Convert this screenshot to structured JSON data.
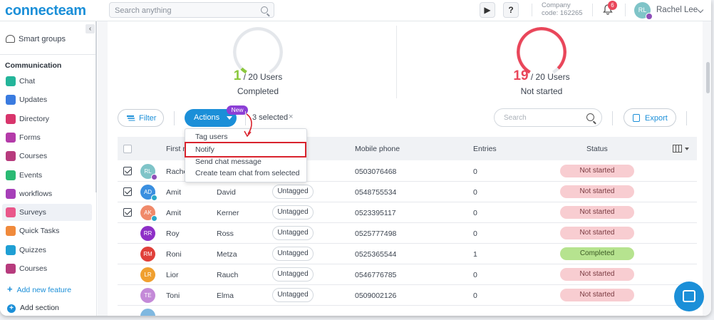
{
  "brand": {
    "logo": "connecteam",
    "accent": "#1b8fd8"
  },
  "topbar": {
    "search_placeholder": "Search anything",
    "help_label": "?",
    "company_line1": "Company",
    "company_line2": "code: 162265",
    "notifications": "6",
    "avatar_initials": "RL",
    "user_name": "Rachel Lee"
  },
  "sidebar": {
    "smart_groups": "Smart groups",
    "section": "Communication",
    "items": [
      {
        "label": "Chat",
        "color": "#24b59a"
      },
      {
        "label": "Updates",
        "color": "#3a7be0"
      },
      {
        "label": "Directory",
        "color": "#d8356c"
      },
      {
        "label": "Forms",
        "color": "#b43ba9"
      },
      {
        "label": "Courses",
        "color": "#b73b7d"
      },
      {
        "label": "Events",
        "color": "#2aba73"
      },
      {
        "label": "workflows",
        "color": "#a63fb8"
      },
      {
        "label": "Surveys",
        "color": "#e9578a"
      },
      {
        "label": "Quick Tasks",
        "color": "#f08a3c"
      },
      {
        "label": "Quizzes",
        "color": "#1f9fd4"
      },
      {
        "label": "Courses",
        "color": "#b73b7d"
      }
    ],
    "add_feature": "Add new feature",
    "add_section": "Add section"
  },
  "stats": {
    "completed": {
      "percent": "5",
      "percent_unit": "%",
      "count": "1",
      "total": "/ 20 Users",
      "label": "Completed",
      "color": "#8ac73c",
      "fraction": 0.05
    },
    "not_started": {
      "percent": "95",
      "percent_unit": "%",
      "count": "19",
      "total": "/ 20 Users",
      "label": "Not started",
      "color": "#e9465a",
      "fraction": 0.95
    }
  },
  "toolbar": {
    "filter": "Filter",
    "actions": "Actions",
    "new_badge": "New",
    "selected": "3  selected",
    "clear": "×",
    "search_placeholder": "Search",
    "export": "Export"
  },
  "dropdown": {
    "items": [
      "Tag users",
      "Notify",
      "Send chat message",
      "Create team chat from selected"
    ]
  },
  "table": {
    "headers": {
      "first": "First n",
      "mobile": "Mobile phone",
      "entries": "Entries",
      "status": "Status"
    },
    "rows": [
      {
        "initials": "RL",
        "color": "#7fc4c8",
        "first": "Rache",
        "last": "",
        "tag": "",
        "phone": "0503076468",
        "entries": "0",
        "status": "Not started",
        "checked": true,
        "sub": "#8e4fb8"
      },
      {
        "initials": "AD",
        "color": "#3a8fe0",
        "first": "Amit",
        "last": "David",
        "tag": "Untagged",
        "phone": "0548755534",
        "entries": "0",
        "status": "Not started",
        "checked": true,
        "sub": "#2aa8c8"
      },
      {
        "initials": "AK",
        "color": "#f08a6a",
        "first": "Amit",
        "last": "Kerner",
        "tag": "Untagged",
        "phone": "0523395117",
        "entries": "0",
        "status": "Not started",
        "checked": true,
        "sub": "#2aa8c8"
      },
      {
        "initials": "RR",
        "color": "#8e2fc7",
        "first": "Roy",
        "last": "Ross",
        "tag": "Untagged",
        "phone": "0525777498",
        "entries": "0",
        "status": "Not started",
        "checked": false,
        "sub": ""
      },
      {
        "initials": "RM",
        "color": "#e0403a",
        "first": "Roni",
        "last": "Metza",
        "tag": "Untagged",
        "phone": "0525365544",
        "entries": "1",
        "status": "Completed",
        "checked": false,
        "sub": ""
      },
      {
        "initials": "LR",
        "color": "#f0a030",
        "first": "Lior",
        "last": "Rauch",
        "tag": "Untagged",
        "phone": "0546776785",
        "entries": "0",
        "status": "Not started",
        "checked": false,
        "sub": ""
      },
      {
        "initials": "TE",
        "color": "#c48ad8",
        "first": "Toni",
        "last": "Elma",
        "tag": "Untagged",
        "phone": "0509002126",
        "entries": "0",
        "status": "Not started",
        "checked": false,
        "sub": ""
      },
      {
        "initials": "",
        "color": "#7fb8e0",
        "first": "",
        "last": "",
        "tag": "",
        "phone": "",
        "entries": "",
        "status": "",
        "checked": false,
        "sub": ""
      }
    ]
  }
}
